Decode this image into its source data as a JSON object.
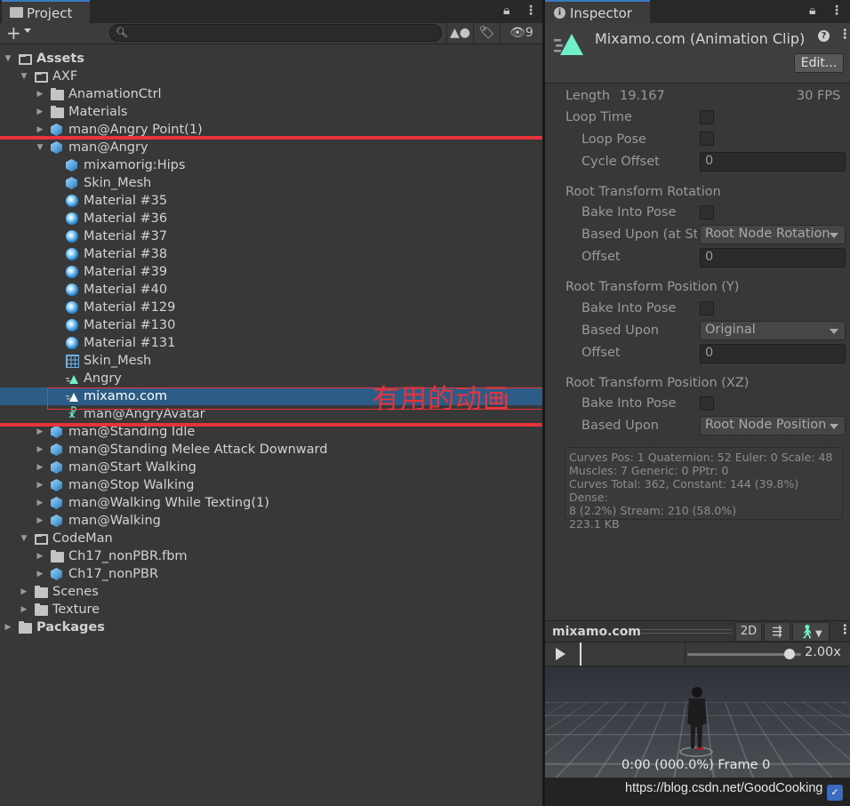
{
  "project": {
    "tab_title": "Project",
    "hidden_count": "9",
    "search": {
      "value": "",
      "placeholder": ""
    },
    "tree": [
      {
        "label": "Assets",
        "depth": 0,
        "icon": "folder-open-icon",
        "arrow": "expanded",
        "bold": true
      },
      {
        "label": "AXF",
        "depth": 1,
        "icon": "folder-open-icon",
        "arrow": "expanded"
      },
      {
        "label": "AnamationCtrl",
        "depth": 2,
        "icon": "folder-icon",
        "arrow": "collapsed"
      },
      {
        "label": "Materials",
        "depth": 2,
        "icon": "folder-icon",
        "arrow": "collapsed"
      },
      {
        "label": "man@Angry Point(1)",
        "depth": 2,
        "icon": "model-icon",
        "arrow": "collapsed"
      },
      {
        "label": "man@Angry",
        "depth": 2,
        "icon": "model-icon",
        "arrow": "expanded"
      },
      {
        "label": "mixamorig:Hips",
        "depth": 3,
        "icon": "model-icon",
        "arrow": "none"
      },
      {
        "label": "Skin_Mesh",
        "depth": 3,
        "icon": "model-icon",
        "arrow": "none"
      },
      {
        "label": "Material #35",
        "depth": 3,
        "icon": "material-icon",
        "arrow": "none"
      },
      {
        "label": "Material #36",
        "depth": 3,
        "icon": "material-icon",
        "arrow": "none"
      },
      {
        "label": "Material #37",
        "depth": 3,
        "icon": "material-icon",
        "arrow": "none"
      },
      {
        "label": "Material #38",
        "depth": 3,
        "icon": "material-icon",
        "arrow": "none"
      },
      {
        "label": "Material #39",
        "depth": 3,
        "icon": "material-icon",
        "arrow": "none"
      },
      {
        "label": "Material #40",
        "depth": 3,
        "icon": "material-icon",
        "arrow": "none"
      },
      {
        "label": "Material #129",
        "depth": 3,
        "icon": "material-icon",
        "arrow": "none"
      },
      {
        "label": "Material #130",
        "depth": 3,
        "icon": "material-icon",
        "arrow": "none"
      },
      {
        "label": "Material #131",
        "depth": 3,
        "icon": "material-icon",
        "arrow": "none"
      },
      {
        "label": "Skin_Mesh",
        "depth": 3,
        "icon": "mesh-icon",
        "arrow": "none"
      },
      {
        "label": "Angry",
        "depth": 3,
        "icon": "animation-clip-icon",
        "arrow": "none"
      },
      {
        "label": "mixamo.com",
        "depth": 3,
        "icon": "animation-clip-icon",
        "arrow": "none",
        "selected": true
      },
      {
        "label": "man@AngryAvatar",
        "depth": 3,
        "icon": "avatar-icon",
        "arrow": "none"
      },
      {
        "label": "man@Standing Idle",
        "depth": 2,
        "icon": "model-icon",
        "arrow": "collapsed"
      },
      {
        "label": "man@Standing Melee Attack Downward",
        "depth": 2,
        "icon": "model-icon",
        "arrow": "collapsed"
      },
      {
        "label": "man@Start Walking",
        "depth": 2,
        "icon": "model-icon",
        "arrow": "collapsed"
      },
      {
        "label": "man@Stop Walking",
        "depth": 2,
        "icon": "model-icon",
        "arrow": "collapsed"
      },
      {
        "label": "man@Walking While Texting(1)",
        "depth": 2,
        "icon": "model-icon",
        "arrow": "collapsed"
      },
      {
        "label": "man@Walking",
        "depth": 2,
        "icon": "model-icon",
        "arrow": "collapsed"
      },
      {
        "label": "CodeMan",
        "depth": 1,
        "icon": "folder-open-icon",
        "arrow": "expanded"
      },
      {
        "label": "Ch17_nonPBR.fbm",
        "depth": 2,
        "icon": "folder-icon",
        "arrow": "collapsed"
      },
      {
        "label": "Ch17_nonPBR",
        "depth": 2,
        "icon": "model-icon",
        "arrow": "collapsed"
      },
      {
        "label": "Scenes",
        "depth": 1,
        "icon": "folder-icon",
        "arrow": "collapsed"
      },
      {
        "label": "Texture",
        "depth": 1,
        "icon": "folder-icon",
        "arrow": "collapsed"
      },
      {
        "label": "Packages",
        "depth": 0,
        "icon": "folder-icon",
        "arrow": "collapsed",
        "bold": true
      }
    ]
  },
  "annotation": {
    "text": "有用的动画",
    "color": "#e8323c"
  },
  "inspector": {
    "tab_title": "Inspector",
    "asset_title": "Mixamo.com (Animation Clip)",
    "edit_button": "Edit...",
    "length_label": "Length",
    "length_value": "19.167",
    "fps": "30 FPS",
    "loop_time": "Loop Time",
    "loop_pose": "Loop Pose",
    "cycle_offset": "Cycle Offset",
    "cycle_offset_value": "0",
    "rot_header": "Root Transform Rotation",
    "rot_bake": "Bake Into Pose",
    "rot_based": "Based Upon (at St",
    "rot_based_value": "Root Node Rotation",
    "rot_offset": "Offset",
    "rot_offset_value": "0",
    "posy_header": "Root Transform Position (Y)",
    "posy_bake": "Bake Into Pose",
    "posy_based": "Based Upon",
    "posy_based_value": "Original",
    "posy_offset": "Offset",
    "posy_offset_value": "0",
    "posxz_header": "Root Transform Position (XZ)",
    "posxz_bake": "Bake Into Pose",
    "posxz_based": "Based Upon",
    "posxz_based_value": "Root Node Position",
    "info_lines": [
      "Curves Pos: 1 Quaternion: 52 Euler: 0 Scale: 48",
      "Muscles: 7 Generic: 0 PPtr: 0",
      "Curves Total: 362, Constant: 144 (39.8%) Dense:",
      "8 (2.2%) Stream: 210 (58.0%)",
      "223.1 KB"
    ]
  },
  "preview": {
    "title": "mixamo.com",
    "mode_2d": "2D",
    "speed": "2.00x",
    "speed_fraction": 0.9,
    "time_readout": "0:00 (000.0%) Frame 0"
  },
  "watermark": "https://blog.csdn.net/GoodCooking"
}
